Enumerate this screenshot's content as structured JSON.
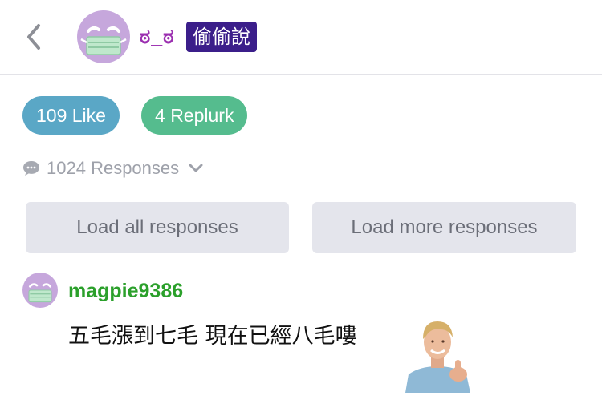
{
  "header": {
    "back_icon": "chevron-left-icon",
    "avatar_icon": "masked-face-avatar-icon",
    "nickname": "ಠ_ಠ",
    "badge": "偷偷說",
    "colors": {
      "nickname": "#9b2fb0",
      "badge_bg": "#3b1e8a"
    }
  },
  "actions": {
    "like_count": "109",
    "like_label": "Like",
    "replurk_count": "4",
    "replurk_label": "Replurk",
    "colors": {
      "like": "#5aa7c6",
      "replurk": "#55bc8e"
    }
  },
  "responses": {
    "icon": "speech-bubble-icon",
    "count": "1024",
    "label": "Responses",
    "toggle_icon": "chevron-down-icon"
  },
  "buttons": {
    "load_all": "Load all responses",
    "load_more": "Load more responses"
  },
  "response": {
    "avatar_icon": "masked-face-avatar-icon",
    "username": "magpie9386",
    "text": "五毛漲到七毛 現在已經八毛嘍",
    "image": "thumbs-up-man-emoticon",
    "colors": {
      "username": "#2ba02b"
    }
  }
}
